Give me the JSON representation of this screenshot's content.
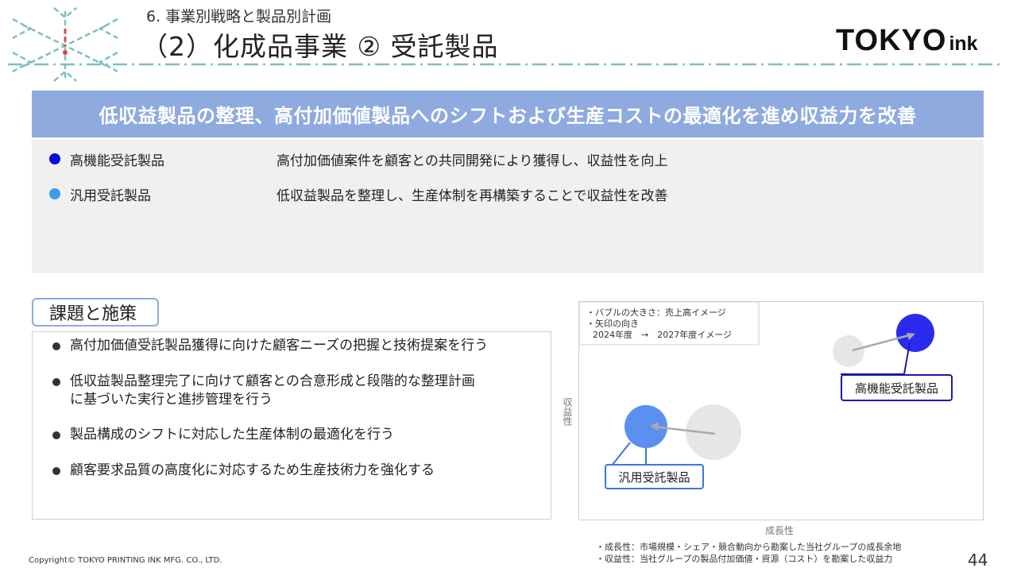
{
  "header": {
    "section": "6. 事業別戦略と製品別計画",
    "title": "（2）化成品事業 ② 受託製品",
    "logo_main": "TOKYO",
    "logo_sub": "ink"
  },
  "banner": "低収益製品の整理、高付加価値製品へのシフトおよび生産コストの最適化を進め収益力を改善",
  "products": [
    {
      "name": "高機能受託製品",
      "desc": "高付加価値案件を顧客との共同開発により獲得し、収益性を向上",
      "color": "#0a0ae6"
    },
    {
      "name": "汎用受託製品",
      "desc": "低収益製品を整理し、生産体制を再構築することで収益性を改善",
      "color": "#3d9be9"
    }
  ],
  "issues_tag": "課題と施策",
  "issues": [
    {
      "line1": "高付加価値受託製品獲得に向けた顧客ニーズの把握と技術提案を行う",
      "line2": ""
    },
    {
      "line1": "低収益製品整理完了に向けて顧客との合意形成と段階的な整理計画",
      "line2": "に基づいた実行と進捗管理を行う"
    },
    {
      "line1": "製品構成のシフトに対応した生産体制の最適化を行う",
      "line2": ""
    },
    {
      "line1": "顧客要求品質の高度化に対応するため生産技術力を強化する",
      "line2": ""
    }
  ],
  "chart_data": {
    "type": "scatter",
    "legend_notes": [
      "・バブルの大きさ：売上高イメージ",
      "・矢印の向き",
      "2024年度　→　2027年度イメージ"
    ],
    "xlabel": "成長性",
    "ylabel": "収益性",
    "series": [
      {
        "name": "高機能受託製品",
        "color": "#2b2bee"
      },
      {
        "name": "汎用受託製品",
        "color": "#5b8ff0"
      }
    ]
  },
  "notes": [
    "・成長性：市場規模・シェア・競合動向から勘案した当社グループの成長余地",
    "・収益性：当社グループの製品付加価値・資源（コスト）を勘案した収益力"
  ],
  "footer": "Copyright© TOKYO PRINTING INK MFG. CO., LTD.",
  "page_number": "44"
}
